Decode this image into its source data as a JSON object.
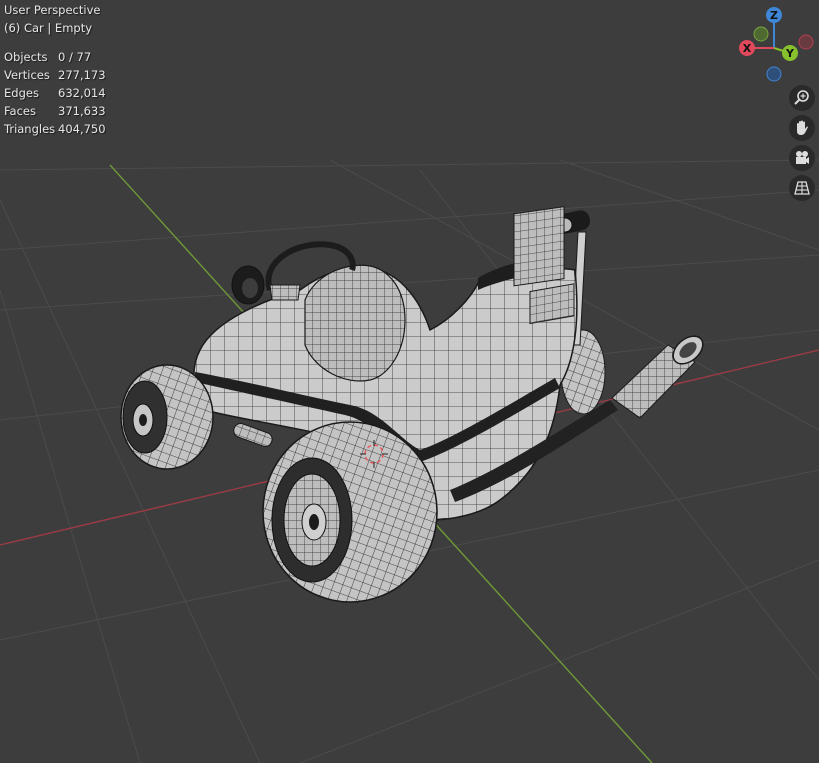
{
  "viewport": {
    "view_name": "User Perspective",
    "active_object": "(6) Car | Empty",
    "stats": [
      {
        "label": "Objects",
        "value": "0 / 77"
      },
      {
        "label": "Vertices",
        "value": "277,173"
      },
      {
        "label": "Edges",
        "value": "632,014"
      },
      {
        "label": "Faces",
        "value": "371,633"
      },
      {
        "label": "Triangles",
        "value": "404,750"
      }
    ]
  },
  "gizmo": {
    "z_label": "Z",
    "y_label": "Y",
    "x_label": "X",
    "colors": {
      "x": "#e0485b",
      "y": "#87c12e",
      "z": "#3f86d6"
    }
  },
  "nav_tools": [
    {
      "name": "zoom-icon"
    },
    {
      "name": "hand-pan-icon"
    },
    {
      "name": "camera-icon"
    },
    {
      "name": "ortho-grid-icon"
    }
  ],
  "scene_colors": {
    "background": "#3d3d3d",
    "grid": "#4d4d4d",
    "x_axis": "#b5404e",
    "y_axis": "#78a53d",
    "mesh": "#c9c9c9",
    "wire": "#1a1a1a"
  }
}
